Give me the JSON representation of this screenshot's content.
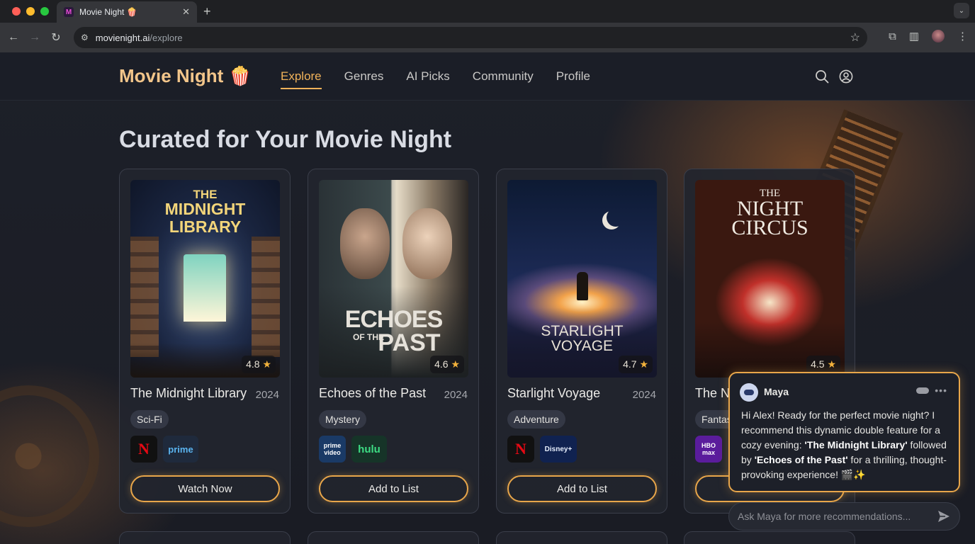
{
  "browser": {
    "tab_title": "Movie Night 🍿",
    "favicon": "M",
    "url_host": "movienight.ai",
    "url_path": "/explore"
  },
  "site": {
    "logo": "Movie Night 🍿",
    "nav": [
      "Explore",
      "Genres",
      "AI Picks",
      "Community",
      "Profile"
    ],
    "active_nav": "Explore"
  },
  "heading": "Curated for Your Movie Night",
  "cards": [
    {
      "poster_lines": [
        "THE",
        "MIDNIGHT",
        "LIBRARY"
      ],
      "rating": "4.8",
      "title": "The Midnight Library",
      "year": "2024",
      "genre": "Sci-Fi",
      "providers": [
        "N",
        "prime"
      ],
      "cta": "Watch Now"
    },
    {
      "poster_lines": [
        "ECHOES",
        "OF THE",
        "PAST"
      ],
      "rating": "4.6",
      "title": "Echoes of the Past",
      "year": "2024",
      "genre": "Mystery",
      "providers": [
        "prime video",
        "hulu"
      ],
      "cta": "Add to List"
    },
    {
      "poster_lines": [
        "STARLIGHT",
        "VOYAGE"
      ],
      "rating": "4.7",
      "title": "Starlight Voyage",
      "year": "2024",
      "genre": "Adventure",
      "providers": [
        "N",
        "Disney+"
      ],
      "cta": "Add to List"
    },
    {
      "poster_lines": [
        "THE",
        "NIGHT",
        "CIRCUS"
      ],
      "rating": "4.5",
      "title": "The N",
      "year": "",
      "genre": "Fantas",
      "providers": [
        "HBO max"
      ],
      "cta": ""
    }
  ],
  "chat": {
    "name": "Maya",
    "message_parts": {
      "p1": "Hi Alex! Ready for the perfect movie night? I recommend this dynamic double feature for a cozy evening: ",
      "b1": "'The Midnight Library'",
      "p2": " followed by ",
      "b2": "'Echoes of the Past'",
      "p3": " for a thrilling, thought-provoking experience! 🎬✨"
    },
    "input_placeholder": "Ask Maya for more recommendations..."
  },
  "colors": {
    "accent": "#f0b25a",
    "button_border": "#e8a64a",
    "background": "#1b1d24"
  }
}
